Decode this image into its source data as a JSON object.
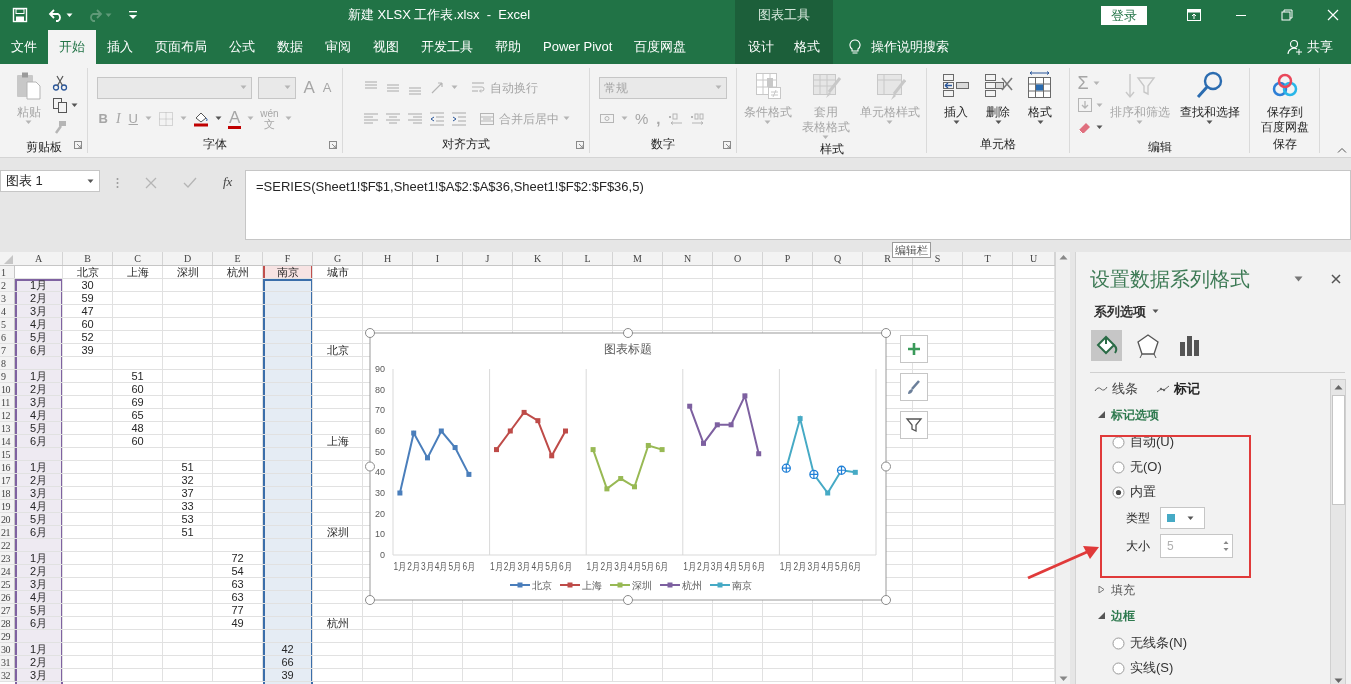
{
  "title_bar": {
    "title": "新建 XLSX 工作表.xlsx  -  Excel",
    "context_label": "图表工具",
    "sign_in": "登录"
  },
  "ribbon_tabs": [
    {
      "label": "文件",
      "selected": false
    },
    {
      "label": "开始",
      "selected": true
    },
    {
      "label": "插入",
      "selected": false
    },
    {
      "label": "页面布局",
      "selected": false
    },
    {
      "label": "公式",
      "selected": false
    },
    {
      "label": "数据",
      "selected": false
    },
    {
      "label": "审阅",
      "selected": false
    },
    {
      "label": "视图",
      "selected": false
    },
    {
      "label": "开发工具",
      "selected": false
    },
    {
      "label": "帮助",
      "selected": false
    },
    {
      "label": "Power Pivot",
      "selected": false
    },
    {
      "label": "百度网盘",
      "selected": false
    }
  ],
  "context_tabs": [
    {
      "label": "设计",
      "selected": false
    },
    {
      "label": "格式",
      "selected": false
    }
  ],
  "tell_me": "操作说明搜索",
  "share": "共享",
  "ribbon_groups": [
    {
      "label": "剪贴板",
      "launcher": true,
      "blocks": [
        {
          "kind": "large",
          "lines": [
            "粘贴"
          ],
          "dropdown": true,
          "disabled": true
        },
        {
          "kind": "stack",
          "rows": [
            [
              {
                "kind": "icon",
                "dropdown": false,
                "disabled": false
              }
            ],
            [
              {
                "kind": "icon",
                "dropdown": true,
                "disabled": false
              }
            ],
            [
              {
                "kind": "icon",
                "dropdown": false,
                "disabled": true
              }
            ]
          ]
        }
      ]
    },
    {
      "label": "字体",
      "launcher": true,
      "blocks": [
        {
          "kind": "stack",
          "rows": [
            [
              {
                "kind": "combo",
                "dropdown": true,
                "disabled": true
              },
              {
                "kind": "combo",
                "dropdown": true,
                "disabled": true
              },
              {
                "kind": "glyph",
                "glyph": "A",
                "dropdown": false,
                "disabled": true
              },
              {
                "kind": "glyph",
                "glyph": "A",
                "dropdown": false,
                "disabled": true
              }
            ],
            [
              {
                "kind": "glyph",
                "glyph": "B",
                "dropdown": false,
                "disabled": true
              },
              {
                "kind": "glyph",
                "glyph": "I",
                "dropdown": false,
                "disabled": true
              },
              {
                "kind": "glyph",
                "glyph": "U",
                "dropdown": true,
                "disabled": true
              },
              {
                "kind": "icon",
                "dropdown": true,
                "disabled": true
              },
              {
                "kind": "icon",
                "dropdown": true,
                "disabled": false
              },
              {
                "kind": "glyph",
                "glyph": "A",
                "dropdown": true,
                "disabled": true
              },
              {
                "kind": "phonetic",
                "top": "wén",
                "bottom": "文",
                "dropdown": true,
                "disabled": true
              }
            ]
          ]
        }
      ]
    },
    {
      "label": "对齐方式",
      "launcher": true,
      "blocks": [
        {
          "kind": "stack",
          "rows": [
            [
              {
                "kind": "icon",
                "dropdown": false,
                "disabled": true
              },
              {
                "kind": "icon",
                "dropdown": false,
                "disabled": true
              },
              {
                "kind": "icon",
                "dropdown": false,
                "disabled": true
              },
              {
                "kind": "icon",
                "dropdown": true,
                "disabled": true
              },
              {
                "kind": "text",
                "label": "自动换行",
                "dropdown": false,
                "disabled": true
              }
            ],
            [
              {
                "kind": "icon",
                "dropdown": false,
                "disabled": true
              },
              {
                "kind": "icon",
                "dropdown": false,
                "disabled": true
              },
              {
                "kind": "icon",
                "dropdown": false,
                "disabled": true
              },
              {
                "kind": "icon",
                "dropdown": false,
                "disabled": true
              },
              {
                "kind": "icon",
                "dropdown": false,
                "disabled": true
              },
              {
                "kind": "text",
                "label": "合并后居中",
                "dropdown": true,
                "disabled": true
              }
            ]
          ]
        }
      ]
    },
    {
      "label": "数字",
      "launcher": true,
      "blocks": [
        {
          "kind": "stack",
          "rows": [
            [
              {
                "kind": "combo",
                "placeholder": "常规",
                "dropdown": true,
                "disabled": true
              }
            ],
            [
              {
                "kind": "icon",
                "dropdown": true,
                "disabled": true
              },
              {
                "kind": "glyph",
                "glyph": "%",
                "dropdown": false,
                "disabled": true
              },
              {
                "kind": "glyph",
                "glyph": ",",
                "dropdown": false,
                "disabled": true
              },
              {
                "kind": "icon",
                "dropdown": false,
                "disabled": true
              },
              {
                "kind": "icon",
                "dropdown": false,
                "disabled": true
              }
            ]
          ]
        }
      ]
    },
    {
      "label": "样式",
      "launcher": false,
      "blocks": [
        {
          "kind": "large",
          "lines": [
            "条件格式"
          ],
          "dropdown": true,
          "disabled": true
        },
        {
          "kind": "large",
          "lines": [
            "套用",
            "表格格式"
          ],
          "dropdown": true,
          "disabled": true
        },
        {
          "kind": "large",
          "lines": [
            "单元格样式"
          ],
          "dropdown": true,
          "disabled": true
        }
      ]
    },
    {
      "label": "单元格",
      "launcher": false,
      "blocks": [
        {
          "kind": "large",
          "lines": [
            "插入"
          ],
          "dropdown": true,
          "disabled": false
        },
        {
          "kind": "large",
          "lines": [
            "删除"
          ],
          "dropdown": true,
          "disabled": false
        },
        {
          "kind": "large",
          "lines": [
            "格式"
          ],
          "dropdown": true,
          "disabled": false
        }
      ]
    },
    {
      "label": "编辑",
      "launcher": false,
      "blocks": [
        {
          "kind": "stack",
          "rows": [
            [
              {
                "kind": "glyph",
                "glyph": "Σ",
                "dropdown": true,
                "disabled": true
              }
            ],
            [
              {
                "kind": "icon",
                "dropdown": true,
                "disabled": true
              }
            ],
            [
              {
                "kind": "icon",
                "dropdown": true,
                "disabled": false
              }
            ]
          ]
        },
        {
          "kind": "large",
          "lines": [
            "排序和筛选"
          ],
          "dropdown": true,
          "disabled": true
        },
        {
          "kind": "large",
          "lines": [
            "查找和选择"
          ],
          "dropdown": true,
          "disabled": false
        }
      ]
    },
    {
      "label": "保存",
      "launcher": false,
      "blocks": [
        {
          "kind": "large",
          "lines": [
            "保存到",
            "百度网盘"
          ],
          "dropdown": false,
          "disabled": false
        }
      ]
    }
  ],
  "formula_bar": {
    "name_box": "图表 1",
    "function_glyph": "fx",
    "formula": "=SERIES(Sheet1!$F$1,Sheet1!$A$2:$A$36,Sheet1!$F$2:$F$36,5)",
    "tooltip": "编辑栏"
  },
  "sheet": {
    "columns": [
      {
        "label": "A",
        "color": "#7f62a1"
      },
      {
        "label": "B"
      },
      {
        "label": "C"
      },
      {
        "label": "D"
      },
      {
        "label": "E"
      },
      {
        "label": "F",
        "color": "#3b6eaa",
        "series_name_mark": true
      },
      {
        "label": "G"
      },
      {
        "label": "H"
      },
      {
        "label": "I"
      },
      {
        "label": "J"
      },
      {
        "label": "K"
      },
      {
        "label": "L"
      },
      {
        "label": "M"
      },
      {
        "label": "N"
      },
      {
        "label": "O"
      },
      {
        "label": "P"
      },
      {
        "label": "Q"
      },
      {
        "label": "R"
      },
      {
        "label": "S"
      },
      {
        "label": "T"
      },
      {
        "label": "U"
      }
    ],
    "rows": [
      {
        "label": "1",
        "cells": {
          "B": "北京",
          "C": "上海",
          "D": "深圳",
          "E": "杭州",
          "F": "南京",
          "G": "城市"
        }
      },
      {
        "label": "2",
        "cells": {
          "A": "1月",
          "B": "30"
        }
      },
      {
        "label": "3",
        "cells": {
          "A": "2月",
          "B": "59"
        }
      },
      {
        "label": "4",
        "cells": {
          "A": "3月",
          "B": "47"
        }
      },
      {
        "label": "5",
        "cells": {
          "A": "4月",
          "B": "60"
        }
      },
      {
        "label": "6",
        "cells": {
          "A": "5月",
          "B": "52"
        }
      },
      {
        "label": "7",
        "cells": {
          "A": "6月",
          "B": "39",
          "G": "北京"
        }
      },
      {
        "label": "8",
        "cells": {}
      },
      {
        "label": "9",
        "cells": {
          "A": "1月",
          "C": "51"
        }
      },
      {
        "label": "10",
        "cells": {
          "A": "2月",
          "C": "60"
        }
      },
      {
        "label": "11",
        "cells": {
          "A": "3月",
          "C": "69"
        }
      },
      {
        "label": "12",
        "cells": {
          "A": "4月",
          "C": "65"
        }
      },
      {
        "label": "13",
        "cells": {
          "A": "5月",
          "C": "48"
        }
      },
      {
        "label": "14",
        "cells": {
          "A": "6月",
          "C": "60",
          "G": "上海"
        }
      },
      {
        "label": "15",
        "cells": {}
      },
      {
        "label": "16",
        "cells": {
          "A": "1月",
          "D": "51"
        }
      },
      {
        "label": "17",
        "cells": {
          "A": "2月",
          "D": "32"
        }
      },
      {
        "label": "18",
        "cells": {
          "A": "3月",
          "D": "37"
        }
      },
      {
        "label": "19",
        "cells": {
          "A": "4月",
          "D": "33"
        }
      },
      {
        "label": "20",
        "cells": {
          "A": "5月",
          "D": "53"
        }
      },
      {
        "label": "21",
        "cells": {
          "A": "6月",
          "D": "51",
          "G": "深圳"
        }
      },
      {
        "label": "22",
        "cells": {}
      },
      {
        "label": "23",
        "cells": {
          "A": "1月",
          "E": "72"
        }
      },
      {
        "label": "24",
        "cells": {
          "A": "2月",
          "E": "54"
        }
      },
      {
        "label": "25",
        "cells": {
          "A": "3月",
          "E": "63"
        }
      },
      {
        "label": "26",
        "cells": {
          "A": "4月",
          "E": "63"
        }
      },
      {
        "label": "27",
        "cells": {
          "A": "5月",
          "E": "77"
        }
      },
      {
        "label": "28",
        "cells": {
          "A": "6月",
          "E": "49",
          "G": "杭州"
        }
      },
      {
        "label": "29",
        "cells": {}
      },
      {
        "label": "30",
        "cells": {
          "A": "1月",
          "F": "42"
        }
      },
      {
        "label": "31",
        "cells": {
          "A": "2月",
          "F": "66"
        }
      },
      {
        "label": "32",
        "cells": {
          "A": "3月",
          "F": "39"
        }
      }
    ]
  },
  "chart": {
    "series_selected": [
      false,
      false,
      false,
      false,
      true
    ],
    "chart_data": {
      "type": "line",
      "title": "图表标题",
      "legend": true,
      "categories": [
        "1月",
        "2月",
        "3月",
        "4月",
        "5月",
        "6月",
        null,
        "1月",
        "2月",
        "3月",
        "4月",
        "5月",
        "6月",
        null,
        "1月",
        "2月",
        "3月",
        "4月",
        "5月",
        "6月",
        null,
        "1月",
        "2月",
        "3月",
        "4月",
        "5月",
        "6月",
        null,
        "1月",
        "2月",
        "3月",
        "4月",
        "5月",
        "6月",
        null
      ],
      "series": [
        {
          "name": "北京",
          "color": "#4a7ebb",
          "marker": "square",
          "values": [
            30,
            59,
            47,
            60,
            52,
            39,
            null,
            null,
            null,
            null,
            null,
            null,
            null,
            null,
            null,
            null,
            null,
            null,
            null,
            null,
            null,
            null,
            null,
            null,
            null,
            null,
            null,
            null,
            null,
            null,
            null,
            null,
            null,
            null,
            null
          ]
        },
        {
          "name": "上海",
          "color": "#be4b48",
          "marker": "square",
          "values": [
            null,
            null,
            null,
            null,
            null,
            null,
            null,
            51,
            60,
            69,
            65,
            48,
            60,
            null,
            null,
            null,
            null,
            null,
            null,
            null,
            null,
            null,
            null,
            null,
            null,
            null,
            null,
            null,
            null,
            null,
            null,
            null,
            null,
            null,
            null
          ]
        },
        {
          "name": "深圳",
          "color": "#98b954",
          "marker": "square",
          "values": [
            null,
            null,
            null,
            null,
            null,
            null,
            null,
            null,
            null,
            null,
            null,
            null,
            null,
            null,
            51,
            32,
            37,
            33,
            53,
            51,
            null,
            null,
            null,
            null,
            null,
            null,
            null,
            null,
            null,
            null,
            null,
            null,
            null,
            null,
            null
          ]
        },
        {
          "name": "杭州",
          "color": "#7d60a0",
          "marker": "square",
          "values": [
            null,
            null,
            null,
            null,
            null,
            null,
            null,
            null,
            null,
            null,
            null,
            null,
            null,
            null,
            null,
            null,
            null,
            null,
            null,
            null,
            null,
            72,
            54,
            63,
            63,
            77,
            49,
            null,
            null,
            null,
            null,
            null,
            null,
            null,
            null
          ]
        },
        {
          "name": "南京",
          "color": "#46aac5",
          "marker": "square",
          "values": [
            null,
            null,
            null,
            null,
            null,
            null,
            null,
            null,
            null,
            null,
            null,
            null,
            null,
            null,
            null,
            null,
            null,
            null,
            null,
            null,
            null,
            null,
            null,
            null,
            null,
            null,
            null,
            null,
            42,
            66,
            39,
            30,
            41,
            40,
            null
          ]
        }
      ],
      "ylim": [
        0,
        90
      ],
      "yticks": [
        {
          "value": 0,
          "label": "0"
        },
        {
          "value": 10,
          "label": "10"
        },
        {
          "value": 20,
          "label": "20"
        },
        {
          "value": 30,
          "label": "30"
        },
        {
          "value": 40,
          "label": "40"
        },
        {
          "value": 50,
          "label": "50"
        },
        {
          "value": 60,
          "label": "60"
        },
        {
          "value": 70,
          "label": "70"
        },
        {
          "value": 80,
          "label": "80"
        },
        {
          "value": 90,
          "label": "90"
        }
      ]
    }
  },
  "format_pane": {
    "title": "设置数据系列格式",
    "options_menu": "系列选项",
    "category_icons": [
      {
        "selected": true
      },
      {
        "selected": false
      },
      {
        "selected": false
      }
    ],
    "sub_tabs": [
      {
        "label": "线条",
        "selected": false
      },
      {
        "label": "标记",
        "selected": true
      }
    ],
    "sections": [
      {
        "label": "标记选项",
        "expanded": true,
        "items": [
          {
            "kind": "radio",
            "label": "自动(U)",
            "selected": false
          },
          {
            "kind": "radio",
            "label": "无(O)",
            "selected": false
          },
          {
            "kind": "radio",
            "label": "内置",
            "selected": true
          },
          {
            "kind": "dropdown",
            "label": "类型",
            "color": "#46aac5"
          },
          {
            "kind": "spinner",
            "label": "大小",
            "value": "5"
          }
        ]
      },
      {
        "label": "填充",
        "expanded": false
      },
      {
        "label": "边框",
        "expanded": true,
        "items": [
          {
            "kind": "radio",
            "label": "无线条(N)",
            "selected": false
          },
          {
            "kind": "radio",
            "label": "实线(S)",
            "selected": false
          }
        ]
      }
    ]
  }
}
